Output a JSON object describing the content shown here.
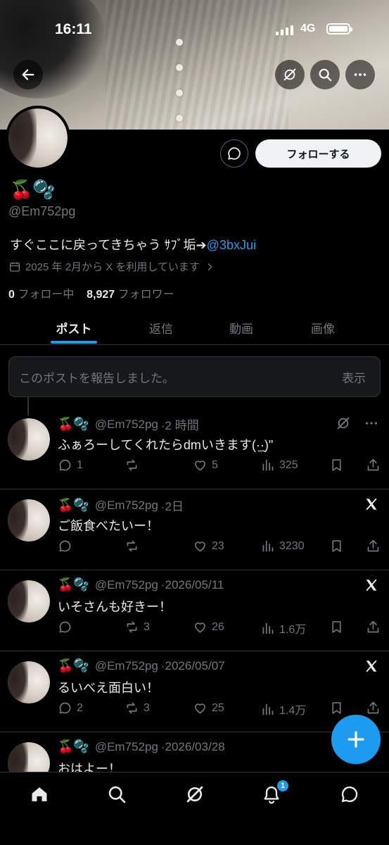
{
  "status": {
    "time": "16:11",
    "network": "4G"
  },
  "profile": {
    "name": "🍒🫧",
    "handle": "@Em752pg",
    "bio_text": "すぐここに戻ってきちゃう ｻﾌﾞ垢➔",
    "bio_mention": "@3bxJui",
    "joined": "2025 年 2月から X を利用しています",
    "following_count": "0",
    "following_label": "フォロー中",
    "followers_count": "8,927",
    "followers_label": "フォロワー",
    "follow_button": "フォローする"
  },
  "tabs": [
    "ポスト",
    "返信",
    "動画",
    "画像"
  ],
  "reported": {
    "text": "このポストを報告しました。",
    "action": "表示"
  },
  "posts": [
    {
      "name": "🍒🫧",
      "handle": "@Em752pg",
      "time": "·2 時間",
      "text": "ふぁろーしてくれたらdmいきます(·̫·̮)\"",
      "replies": "1",
      "reposts": "",
      "likes": "5",
      "views": "325",
      "corner": "grok"
    },
    {
      "name": "🍒🫧",
      "handle": "@Em752pg",
      "time": "·2日",
      "text": "ご飯食べたいー！",
      "replies": "",
      "reposts": "",
      "likes": "23",
      "views": "3230",
      "corner": "x"
    },
    {
      "name": "🍒🫧",
      "handle": "@Em752pg",
      "time": "·2026/05/11",
      "text": "いそさんも好きー！",
      "replies": "",
      "reposts": "3",
      "likes": "26",
      "views": "1.6万",
      "corner": "x"
    },
    {
      "name": "🍒🫧",
      "handle": "@Em752pg",
      "time": "·2026/05/07",
      "text": "るいべえ面白い！",
      "replies": "2",
      "reposts": "3",
      "likes": "25",
      "views": "1.4万",
      "corner": "x"
    },
    {
      "name": "🍒🫧",
      "handle": "@Em752pg",
      "time": "·2026/03/28",
      "text": "おはよー！",
      "replies": "",
      "reposts": "",
      "likes": "",
      "views": "",
      "corner": ""
    }
  ],
  "nav": {
    "notification_badge": "1"
  },
  "colors": {
    "accent": "#1d9bf0",
    "background": "#000000",
    "muted": "#71767b"
  }
}
